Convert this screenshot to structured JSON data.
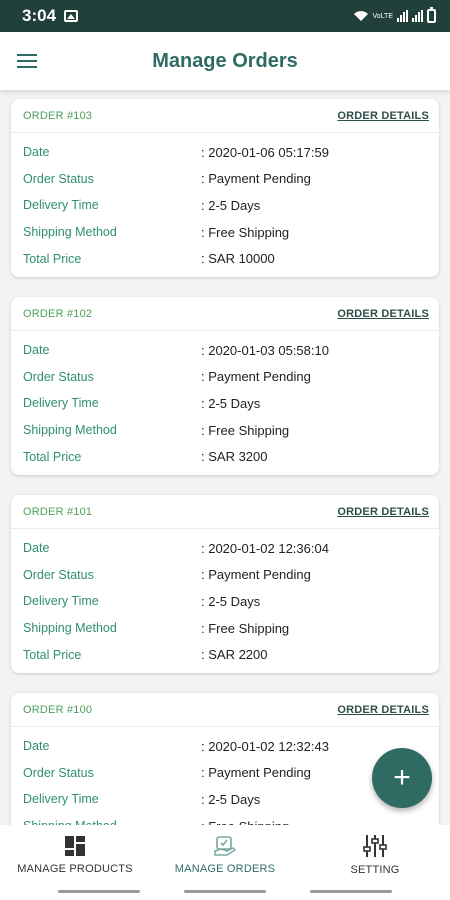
{
  "status_bar": {
    "time": "3:04",
    "network": "VoLTE"
  },
  "app_bar": {
    "title": "Manage Orders"
  },
  "details_link": "ORDER DETAILS",
  "labels": {
    "date": "Date",
    "status": "Order Status",
    "delivery": "Delivery Time",
    "shipping": "Shipping Method",
    "total": "Total Price"
  },
  "orders": [
    {
      "number": "ORDER #103",
      "date": ": 2020-01-06 05:17:59",
      "status": ": Payment Pending",
      "delivery": ": 2-5 Days",
      "shipping": ": Free Shipping",
      "total": ": SAR 10000"
    },
    {
      "number": "ORDER #102",
      "date": ": 2020-01-03 05:58:10",
      "status": ": Payment Pending",
      "delivery": ": 2-5 Days",
      "shipping": ": Free Shipping",
      "total": ": SAR 3200"
    },
    {
      "number": "ORDER #101",
      "date": ": 2020-01-02 12:36:04",
      "status": ": Payment Pending",
      "delivery": ": 2-5 Days",
      "shipping": ": Free Shipping",
      "total": ": SAR 2200"
    },
    {
      "number": "ORDER #100",
      "date": ": 2020-01-02 12:32:43",
      "status": ": Payment Pending",
      "delivery": ": 2-5 Days",
      "shipping": ": Free Shipping",
      "total": ""
    }
  ],
  "fab": {
    "icon": "plus-icon",
    "symbol": "+"
  },
  "bottom_nav": [
    {
      "label": "MANAGE PRODUCTS",
      "icon": "grid-icon",
      "active": false
    },
    {
      "label": "MANAGE ORDERS",
      "icon": "orders-icon",
      "active": true
    },
    {
      "label": "SETTING",
      "icon": "sliders-icon",
      "active": false
    }
  ],
  "colors": {
    "primary": "#2f6b63",
    "accent_green": "#4c9e5a",
    "label_green": "#2f8f73",
    "status_bar": "#21403a"
  }
}
